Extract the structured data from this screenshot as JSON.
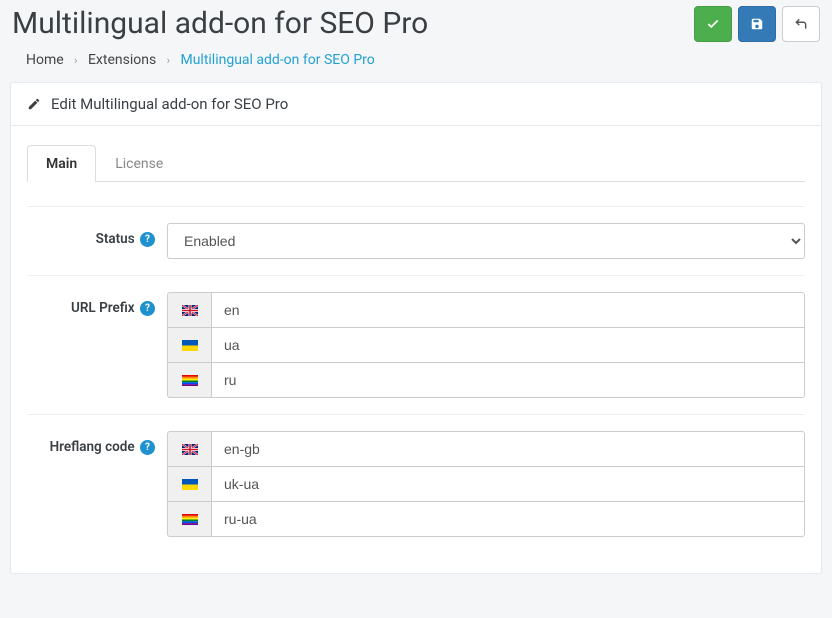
{
  "header": {
    "title": "Multilingual add-on for SEO Pro"
  },
  "breadcrumb": {
    "home": "Home",
    "extensions": "Extensions",
    "current": "Multilingual add-on for SEO Pro"
  },
  "panel": {
    "title": "Edit Multilingual add-on for SEO Pro"
  },
  "tabs": {
    "main": "Main",
    "license": "License"
  },
  "form": {
    "status": {
      "label": "Status",
      "value": "Enabled"
    },
    "url_prefix": {
      "label": "URL Prefix",
      "rows": [
        {
          "flag": "gb",
          "value": "en"
        },
        {
          "flag": "ua",
          "value": "ua"
        },
        {
          "flag": "rainbow",
          "value": "ru"
        }
      ]
    },
    "hreflang": {
      "label": "Hreflang code",
      "rows": [
        {
          "flag": "gb",
          "value": "en-gb"
        },
        {
          "flag": "ua",
          "value": "uk-ua"
        },
        {
          "flag": "rainbow",
          "value": "ru-ua"
        }
      ]
    }
  }
}
